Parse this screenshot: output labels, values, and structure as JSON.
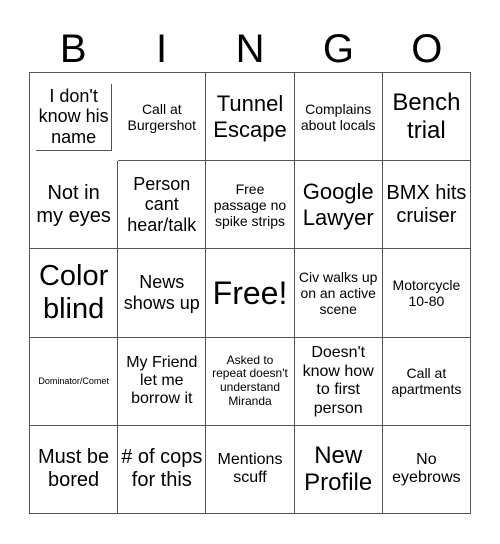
{
  "header": {
    "letters": [
      "B",
      "I",
      "N",
      "G",
      "O"
    ]
  },
  "board": {
    "rows": [
      [
        "I don't know his name",
        "Call at Burgershot",
        "Tunnel Escape",
        "Complains about locals",
        "Bench trial"
      ],
      [
        "Not in my eyes",
        "Person cant hear/talk",
        "Free passage no spike strips",
        "Google Lawyer",
        "BMX hits cruiser"
      ],
      [
        "Color blind",
        "News shows up",
        "Free!",
        "Civ walks up on an active scene",
        "Motorcycle 10-80"
      ],
      [
        "Dominator/Comet",
        "My Friend let me borrow it",
        "Asked to repeat doesn't understand Miranda",
        "Doesn't know how to first person",
        "Call at apartments"
      ],
      [
        "Must be bored",
        "# of cops for this",
        "Mentions scuff",
        "New Profile",
        "No eyebrows"
      ]
    ],
    "free_space": "Free!"
  }
}
